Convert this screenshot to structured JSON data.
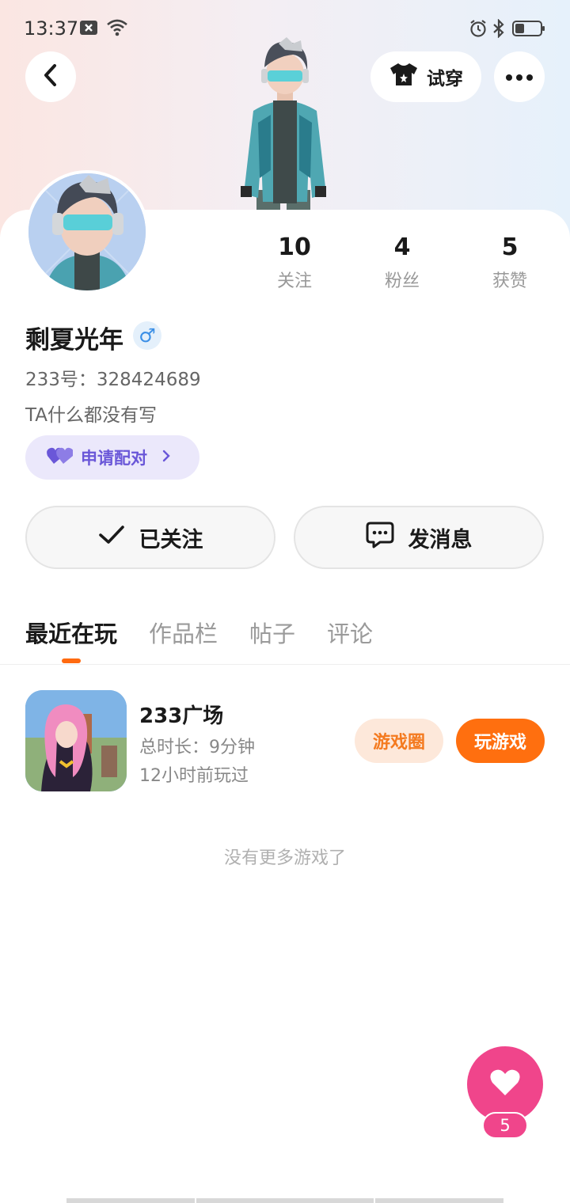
{
  "status_bar": {
    "time": "13:37",
    "icons": [
      "notification-x-icon",
      "wifi-icon",
      "alarm-icon",
      "bluetooth-icon",
      "battery-icon"
    ]
  },
  "header": {
    "back_icon": "chevron-left-icon",
    "try_on_label": "试穿",
    "try_on_icon": "shirt-icon",
    "more_icon": "more-dots-icon"
  },
  "profile": {
    "nickname": "剩夏光年",
    "gender_symbol": "♂",
    "id_line": "233号：328424689",
    "bio": "TA什么都没有写",
    "pair_label": "申请配对",
    "stats": [
      {
        "value": "10",
        "label": "关注"
      },
      {
        "value": "4",
        "label": "粉丝"
      },
      {
        "value": "5",
        "label": "获赞"
      }
    ]
  },
  "actions": {
    "follow_label": "已关注",
    "message_label": "发消息"
  },
  "tabs": [
    {
      "label": "最近在玩",
      "active": true
    },
    {
      "label": "作品栏",
      "active": false
    },
    {
      "label": "帖子",
      "active": false
    },
    {
      "label": "评论",
      "active": false
    }
  ],
  "recent_games": [
    {
      "title": "233广场",
      "duration": "总时长：9分钟",
      "last_played": "12小时前玩过",
      "circle_label": "游戏圈",
      "play_label": "玩游戏"
    }
  ],
  "no_more_text": "没有更多游戏了",
  "like": {
    "count": "5"
  },
  "colors": {
    "accent_orange": "#ff6f0f",
    "like_pink": "#f0458b",
    "pair_purple": "#6a57d8",
    "gender_blue": "#3b8fe6"
  }
}
